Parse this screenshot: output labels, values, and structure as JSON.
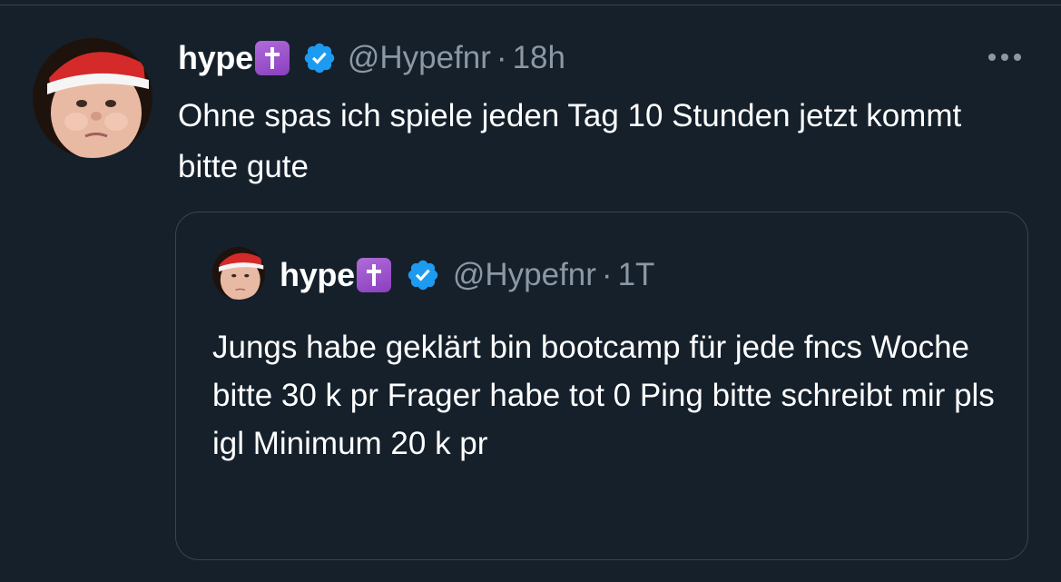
{
  "colors": {
    "background": "#15202b",
    "secondary_text": "#8b98a5",
    "border": "#38444d",
    "verified": "#1d9bf0",
    "badge": "#9a4fd0"
  },
  "tweet": {
    "author_name": "hype",
    "name_badge_icon": "latin-cross-icon",
    "verified_icon": "verified-badge-icon",
    "handle": "@Hypefnr",
    "separator": "·",
    "time": "18h",
    "more_icon": "more-options-icon",
    "text": "Ohne spas ich spiele jeden Tag 10 Stunden jetzt kommt bitte gute"
  },
  "quoted_tweet": {
    "author_name": "hype",
    "name_badge_icon": "latin-cross-icon",
    "verified_icon": "verified-badge-icon",
    "handle": "@Hypefnr",
    "separator": "·",
    "time": "1T",
    "text": "Jungs habe geklärt bin bootcamp für jede fncs Woche bitte 30 k pr Frager habe tot 0 Ping bitte schreibt mir pls igl Minimum 20 k pr"
  }
}
